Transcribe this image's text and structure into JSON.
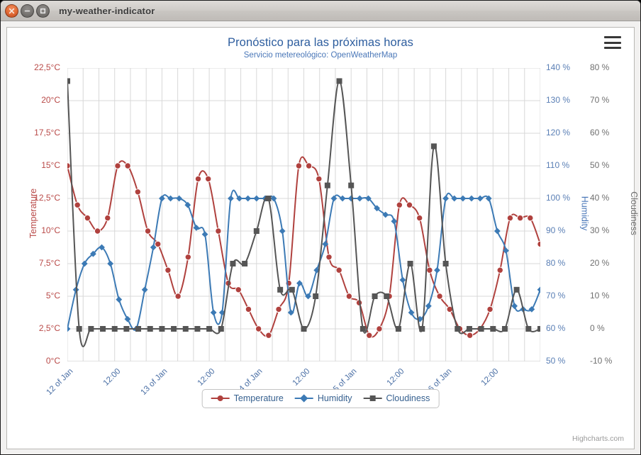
{
  "window": {
    "title": "my-weather-indicator",
    "buttons": [
      {
        "name": "close",
        "icon": "close-icon"
      },
      {
        "name": "minimize",
        "icon": "minimize-icon"
      },
      {
        "name": "maximize",
        "icon": "maximize-icon"
      }
    ]
  },
  "chart": {
    "menu_icon": "hamburger-menu-icon",
    "credits": "Highcharts.com"
  },
  "colors": {
    "temperature": "#b0413e",
    "humidity": "#3c7ab5",
    "cloudiness": "#555555",
    "title": "#2d5d9e",
    "subtitle": "#4a77b8",
    "grid": "#d8d8d8"
  },
  "chart_data": {
    "type": "line",
    "title": "Pronóstico para las próximas horas",
    "subtitle": "Servicio metereológico: OpenWeatherMap",
    "xlabel": "",
    "grid": true,
    "legend_position": "bottom",
    "x_tick_labels": [
      "12 of Jan",
      "12:00",
      "13 of Jan",
      "12:00",
      "14 of Jan",
      "12:00",
      "15 of Jan",
      "12:00",
      "16 of Jan",
      "12:00"
    ],
    "x_points": 30,
    "axes": [
      {
        "name": "Temperature",
        "side": "left",
        "color": "#b0413e",
        "ticks": [
          "0°C",
          "2,5°C",
          "5°C",
          "7,5°C",
          "10°C",
          "12,5°C",
          "15°C",
          "17,5°C",
          "20°C",
          "22,5°C"
        ],
        "min": 0,
        "max": 22.5,
        "step": 2.5,
        "unit": "°C"
      },
      {
        "name": "Humidity",
        "side": "right",
        "color": "#4a77b8",
        "ticks": [
          "50 %",
          "60 %",
          "70 %",
          "80 %",
          "90 %",
          "100 %",
          "110 %",
          "120 %",
          "130 %",
          "140 %"
        ],
        "min": 50,
        "max": 140,
        "step": 10,
        "unit": "%"
      },
      {
        "name": "Cloudiness",
        "side": "right",
        "color": "#6e6e6e",
        "ticks": [
          "-10 %",
          "0 %",
          "10 %",
          "20 %",
          "30 %",
          "40 %",
          "50 %",
          "60 %",
          "70 %",
          "80 %"
        ],
        "min": -10,
        "max": 80,
        "step": 10,
        "unit": "%"
      }
    ],
    "series": [
      {
        "name": "Temperature",
        "color": "#b0413e",
        "marker": "circle",
        "axis": "Temperature",
        "unit": "°C",
        "values": [
          15,
          12,
          11,
          10,
          11,
          15,
          15,
          13,
          10,
          9,
          7,
          5,
          8,
          14,
          14,
          10,
          6,
          5.5,
          4,
          2.5,
          2,
          4,
          6,
          15,
          15,
          14,
          8,
          7,
          5,
          4.5,
          2,
          2.5,
          5,
          12,
          12,
          11,
          7,
          5,
          4,
          2.5,
          2,
          2.5,
          4,
          7,
          11,
          11,
          11,
          9
        ]
      },
      {
        "name": "Humidity",
        "color": "#3c7ab5",
        "marker": "diamond",
        "axis": "Humidity",
        "unit": "%",
        "values": [
          60,
          72,
          80,
          83,
          85,
          80,
          69,
          63,
          60,
          72,
          85,
          100,
          100,
          100,
          98,
          91,
          89,
          65,
          65,
          100,
          100,
          100,
          100,
          100,
          100,
          90,
          65,
          74,
          70,
          78,
          86,
          100,
          100,
          100,
          100,
          100,
          97,
          95,
          93,
          75,
          65,
          63,
          67,
          78,
          100,
          100,
          100,
          100,
          100,
          100,
          90,
          84,
          67,
          66,
          66,
          72
        ]
      },
      {
        "name": "Cloudiness",
        "color": "#555555",
        "marker": "square",
        "axis": "Cloudiness",
        "unit": "%",
        "values": [
          76,
          0,
          0,
          0,
          0,
          0,
          0,
          0,
          0,
          0,
          0,
          0,
          0,
          0,
          20,
          20,
          30,
          40,
          12,
          12,
          0,
          10,
          44,
          76,
          44,
          0,
          10,
          10,
          0,
          20,
          0,
          56,
          20,
          0,
          0,
          0,
          0,
          0,
          12,
          0,
          0
        ]
      }
    ]
  },
  "legend": {
    "items": [
      {
        "label": "Temperature",
        "color": "#b0413e",
        "marker": "circle"
      },
      {
        "label": "Humidity",
        "color": "#3c7ab5",
        "marker": "diamond"
      },
      {
        "label": "Cloudiness",
        "color": "#555555",
        "marker": "square"
      }
    ]
  }
}
